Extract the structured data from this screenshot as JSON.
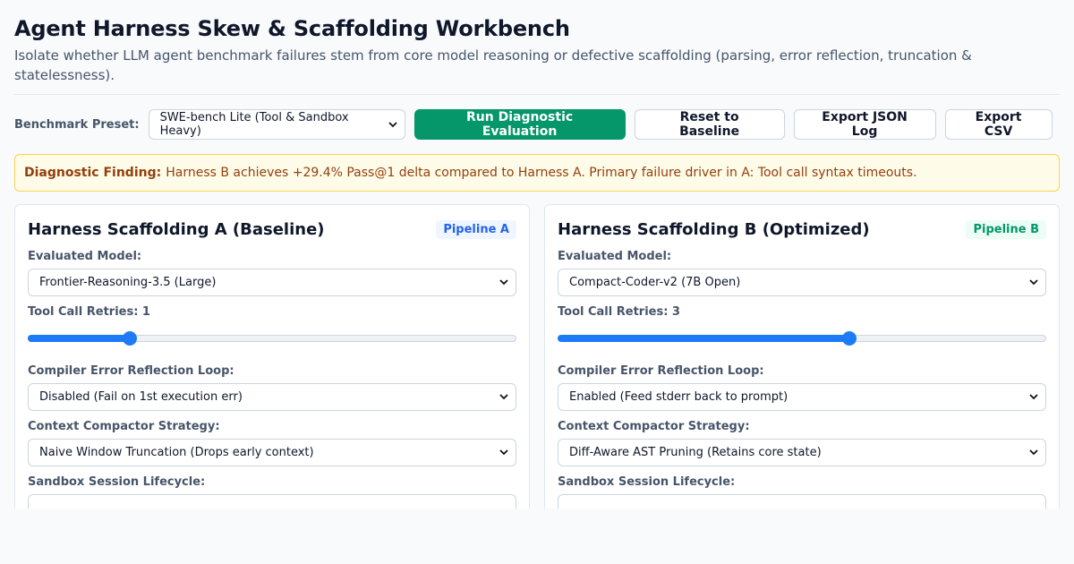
{
  "header": {
    "title": "Agent Harness Skew & Scaffolding Workbench",
    "subtitle": "Isolate whether LLM agent benchmark failures stem from core model reasoning or defective scaffolding (parsing, error reflection, truncation & statelessness)."
  },
  "toolbar": {
    "preset_label": "Benchmark Preset:",
    "preset_value": "SWE-bench Lite (Tool & Sandbox Heavy)",
    "run_label": "Run Diagnostic Evaluation",
    "reset_label": "Reset to Baseline",
    "export_json_label": "Export JSON Log",
    "export_csv_label": "Export CSV"
  },
  "finding": {
    "label": "Diagnostic Finding:",
    "text": "Harness B achieves +29.4% Pass@1 delta compared to Harness A. Primary failure driver in A: Tool call syntax timeouts."
  },
  "panels": {
    "a": {
      "title": "Harness Scaffolding A (Baseline)",
      "badge": "Pipeline A",
      "model_label": "Evaluated Model:",
      "model_value": "Frontier-Reasoning-3.5 (Large)",
      "retries_label": "Tool Call Retries: 1",
      "retries_fraction": 0.2,
      "reflection_label": "Compiler Error Reflection Loop:",
      "reflection_value": "Disabled (Fail on 1st execution err)",
      "compactor_label": "Context Compactor Strategy:",
      "compactor_value": "Naive Window Truncation (Drops early context)",
      "sandbox_label": "Sandbox Session Lifecycle:"
    },
    "b": {
      "title": "Harness Scaffolding B (Optimized)",
      "badge": "Pipeline B",
      "model_label": "Evaluated Model:",
      "model_value": "Compact-Coder-v2 (7B Open)",
      "retries_label": "Tool Call Retries: 3",
      "retries_fraction": 0.6,
      "reflection_label": "Compiler Error Reflection Loop:",
      "reflection_value": "Enabled (Feed stderr back to prompt)",
      "compactor_label": "Context Compactor Strategy:",
      "compactor_value": "Diff-Aware AST Pruning (Retains core state)",
      "sandbox_label": "Sandbox Session Lifecycle:"
    }
  },
  "icons": {
    "chevron": "chevron-down-icon"
  }
}
